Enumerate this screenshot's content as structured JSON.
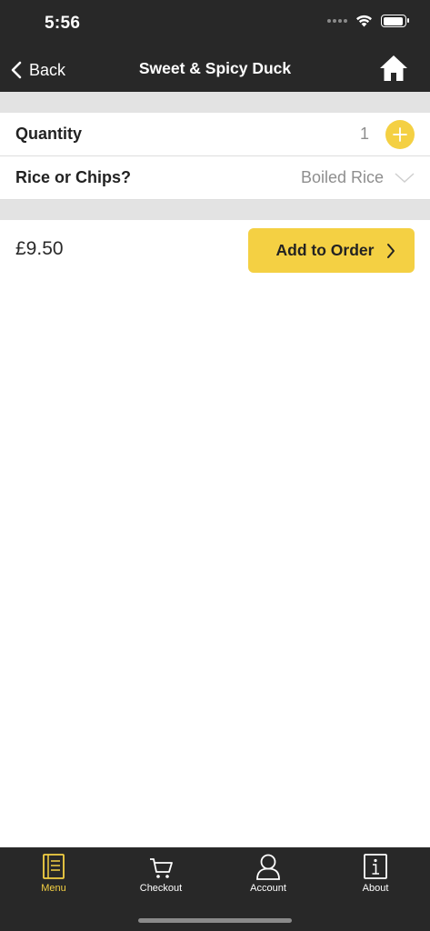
{
  "status_bar": {
    "time": "5:56"
  },
  "nav": {
    "back_label": "Back",
    "title": "Sweet & Spicy Duck"
  },
  "options": {
    "quantity": {
      "label": "Quantity",
      "value": "1"
    },
    "side": {
      "label": "Rice or Chips?",
      "selected": "Boiled Rice"
    }
  },
  "order": {
    "price": "£9.50",
    "add_label": "Add to Order"
  },
  "tabs": [
    {
      "label": "Menu",
      "icon": "menu-book-icon",
      "active": true
    },
    {
      "label": "Checkout",
      "icon": "cart-icon",
      "active": false
    },
    {
      "label": "Account",
      "icon": "person-icon",
      "active": false
    },
    {
      "label": "About",
      "icon": "info-icon",
      "active": false
    }
  ],
  "colors": {
    "accent": "#f4d043",
    "bar": "#282828",
    "separator": "#e3e3e3"
  }
}
